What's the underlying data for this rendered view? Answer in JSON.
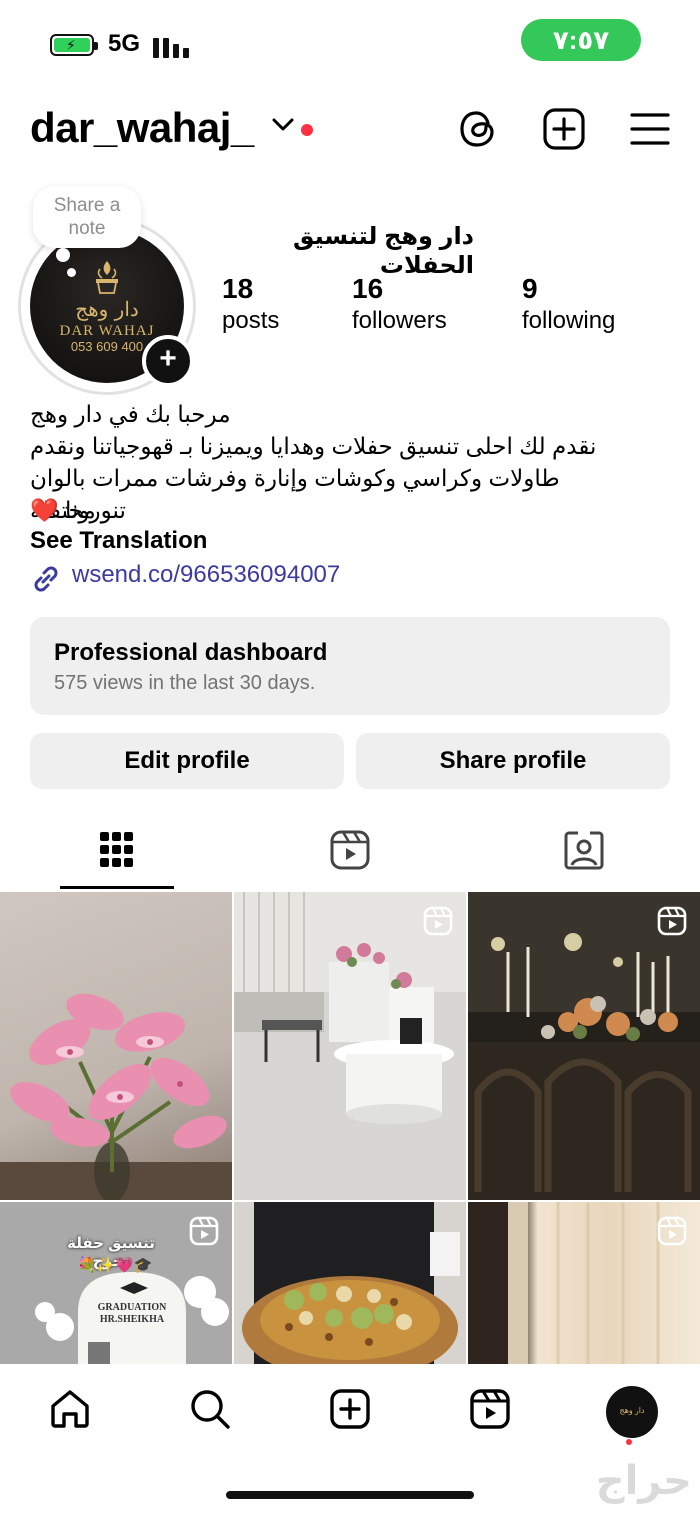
{
  "status_bar": {
    "network": "5G",
    "time": "٧:٥٧",
    "time_pill_color": "#34c759",
    "battery_color": "#30d158",
    "icons": [
      "battery-charging-icon",
      "signal-bars-icon"
    ]
  },
  "header": {
    "username": "dar_wahaj_",
    "notification_dot_color": "#ff3040",
    "icons": [
      "chevron-down-icon",
      "threads-icon",
      "create-plus-icon",
      "menu-icon"
    ]
  },
  "profile": {
    "note_placeholder": "Share a note",
    "avatar_arabic": "دار وهج",
    "avatar_english": "DAR WAHAJ",
    "avatar_phone": "053 609 400",
    "display_name": "دار وهج لتنسيق الحفلات",
    "stats": [
      {
        "number": "18",
        "label": "posts"
      },
      {
        "number": "16",
        "label": "followers"
      },
      {
        "number": "9",
        "label": "following"
      }
    ]
  },
  "bio": {
    "lines": [
      "مرحبا بك في دار وهج",
      "نقدم لك احلى تنسيق حفلات وهدايا ويميزنا بـ قهوجياتنا ونقدم",
      "طاولات وكراسي وكوشات وإنارة وفرشات ممرات بالوان مختفله",
      "تنورونا ❤️"
    ],
    "see_translation": "See Translation",
    "link": "wsend.co/966536094007"
  },
  "dashboard": {
    "title": "Professional dashboard",
    "subtitle": "575 views in the last 30 days."
  },
  "buttons": {
    "edit": "Edit profile",
    "share": "Share profile"
  },
  "tabs": [
    "grid-icon",
    "reels-icon",
    "tagged-icon"
  ],
  "posts": [
    {
      "kind": "photo",
      "description_icon": "pink-lilies-photo"
    },
    {
      "kind": "reel",
      "description_icon": "lounge-photo"
    },
    {
      "kind": "reel",
      "description_icon": "event-tables-photo"
    },
    {
      "kind": "reel",
      "overlay_title": "تنسيق حفلة تخرج",
      "overlay_emoji": "💐✨💗🎓",
      "sign_text": "GRADUATION\nHR.SHEIKHA"
    },
    {
      "kind": "photo",
      "description_icon": "pastry-tray-photo"
    },
    {
      "kind": "reel",
      "description_icon": "curtain-photo"
    }
  ],
  "bottom_nav": [
    "home-icon",
    "search-icon",
    "create-icon",
    "reels-icon",
    "profile-avatar"
  ],
  "watermark": "حراج"
}
